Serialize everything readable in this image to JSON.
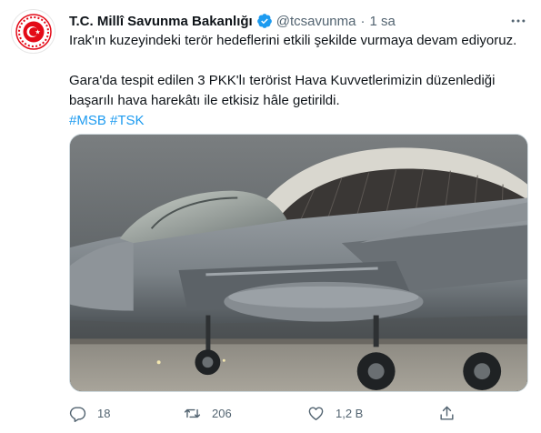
{
  "tweet": {
    "author_name": "T.C. Millî Savunma Bakanlığı",
    "handle": "@tcsavunma",
    "separator": "·",
    "time": "1 sa",
    "line1": "Irak'ın kuzeyindeki terör hedeflerini etkili şekilde vurmaya devam ediyoruz.",
    "line2": "Gara'da tespit edilen 3 PKK'lı terörist Hava Kuvvetlerimizin düzenlediği",
    "line3": "başarılı hava harekâtı ile etkisiz hâle getirildi.",
    "hashtag1": "#MSB",
    "hashtag2": "#TSK",
    "media_icon": "fighter-jet-video-frame"
  },
  "actions": {
    "reply_count": "18",
    "retweet_count": "206",
    "like_count": "1,2 B",
    "icons": [
      "reply-icon",
      "retweet-icon",
      "like-icon",
      "share-icon"
    ]
  },
  "colors": {
    "link": "#1d9bf0",
    "secondary_text": "#536471",
    "verified_badge": "#1d9bf0",
    "logo_red": "#e30a17"
  }
}
